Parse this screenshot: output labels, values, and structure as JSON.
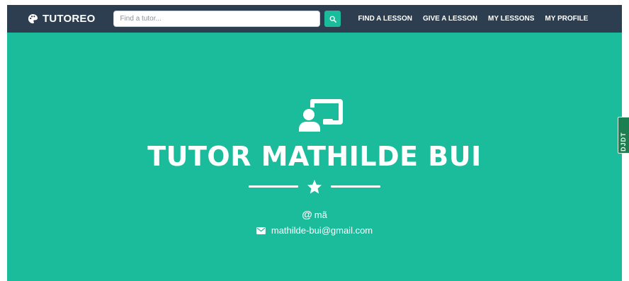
{
  "navbar": {
    "brand": "TUTOREO",
    "brand_icon": "palette-icon",
    "search": {
      "placeholder": "Find a tutor...",
      "value": "",
      "button_icon": "search-icon"
    },
    "links": [
      {
        "label": "FIND A LESSON"
      },
      {
        "label": "GIVE A LESSON"
      },
      {
        "label": "MY LESSONS"
      },
      {
        "label": "MY PROFILE"
      }
    ]
  },
  "masthead": {
    "icon": "chalkboard-teacher-icon",
    "title": "TUTOR MATHILDE BUI",
    "divider_icon": "star-icon",
    "username": "mã",
    "email": "mathilde-bui@gmail.com"
  },
  "side_tab": {
    "label": "DJDT"
  },
  "colors": {
    "navbar_bg": "#2c3e50",
    "accent": "#1abc9c",
    "text_light": "#ffffff",
    "side_tab_bg": "#1b7f52"
  }
}
